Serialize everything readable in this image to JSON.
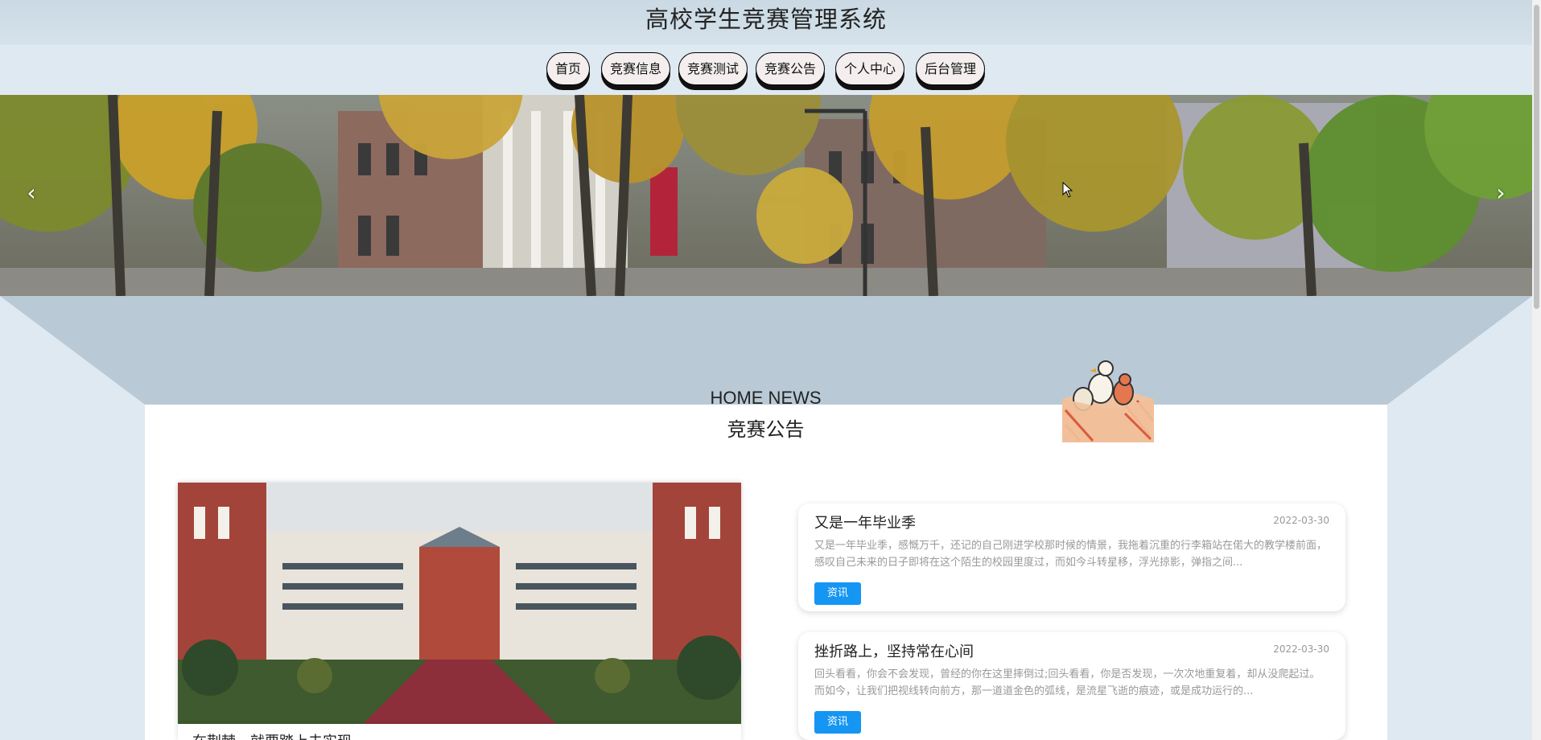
{
  "header": {
    "title": "高校学生竞赛管理系统"
  },
  "nav": {
    "items": [
      {
        "label": "首页"
      },
      {
        "label": "竞赛信息"
      },
      {
        "label": "竞赛测试"
      },
      {
        "label": "竞赛公告"
      },
      {
        "label": "个人中心"
      },
      {
        "label": "后台管理"
      }
    ]
  },
  "banner": {
    "prev_icon": "chevron-left-icon",
    "next_icon": "chevron-right-icon"
  },
  "section": {
    "title_en": "HOME NEWS",
    "title_cn": "竞赛公告"
  },
  "featured": {
    "caption": "在荆棘，就要踏上去实现"
  },
  "news": [
    {
      "title": "又是一年毕业季",
      "date": "2022-03-30",
      "excerpt": "又是一年毕业季，感慨万千，还记的自己刚进学校那时候的情景，我拖着沉重的行李箱站在偌大的教学楼前面，感叹自己未来的日子即将在这个陌生的校园里度过，而如今斗转星移，浮光掠影，弹指之间...",
      "tag": "资讯"
    },
    {
      "title": "挫折路上，坚持常在心间",
      "date": "2022-03-30",
      "excerpt": "回头看看，你会不会发现，曾经的你在这里摔倒过;回头看看，你是否发现，一次次地重复着，却从没爬起过。而如今，让我们把视线转向前方，那一道道金色的弧线，是流星飞逝的痕迹，或是成功运行的...",
      "tag": "资讯"
    }
  ],
  "colors": {
    "accent": "#1596f2",
    "page_bg": "#dfe9f2",
    "band": "#b9cad6"
  }
}
